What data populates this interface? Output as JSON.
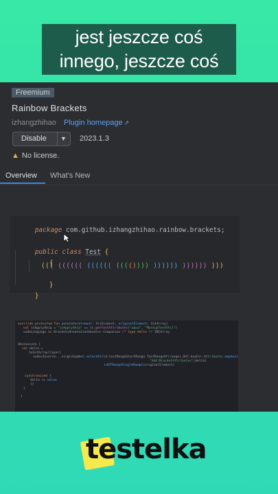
{
  "caption": {
    "line1": "jest jeszcze coś",
    "line2": "innego, jeszcze coś"
  },
  "plugin": {
    "badge": "Freemium",
    "title": "Rainbow Brackets",
    "author": "izhangzhihao",
    "homepage_label": "Plugin homepage",
    "homepage_arrow": "↗",
    "disable_label": "Disable",
    "dropdown_icon": "chevron-down-icon",
    "version": "2023.1.3",
    "license_icon": "warning-icon",
    "license_text": "No license."
  },
  "tabs": [
    {
      "label": "Overview",
      "active": true
    },
    {
      "label": "What's New",
      "active": false
    }
  ],
  "code_sample": {
    "kw_package": "package",
    "package_name": "com.github.izhangzhihao.rainbow.brackets;",
    "kw_public": "public",
    "kw_class": "class",
    "class_name": "Test",
    "open_brace": "{",
    "inner_open": "{",
    "inner_close": "}",
    "close_brace": "}"
  },
  "colors": {
    "ide_background": "#2b2d30",
    "accent_link": "#5ea3f2",
    "tab_underline": "#3d8ae0",
    "bracket_colors": [
      "#e8bf6a",
      "#c77dbb",
      "#56a8f5",
      "#5fbf6f",
      "#e88a3c"
    ]
  },
  "brand": {
    "logo_text": "testelka",
    "highlight_color": "#f5e94b"
  }
}
